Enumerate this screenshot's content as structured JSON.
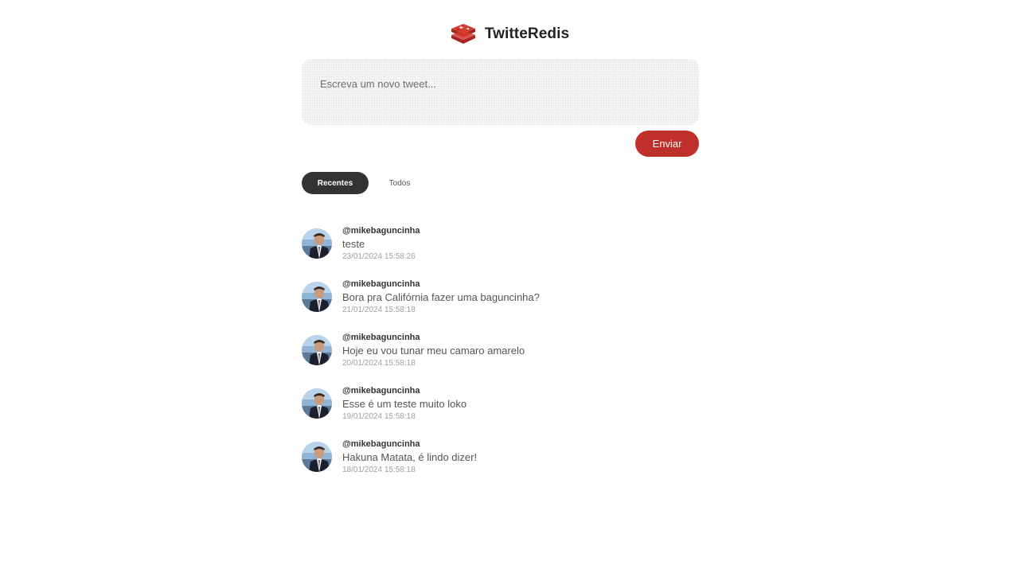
{
  "header": {
    "title": "TwitteRedis",
    "logo_icon": "redis-logo-icon",
    "brand_color": "#c0302b"
  },
  "composer": {
    "placeholder": "Escreva um novo tweet...",
    "value": "",
    "send_label": "Enviar"
  },
  "tabs": [
    {
      "label": "Recentes",
      "active": true
    },
    {
      "label": "Todos",
      "active": false
    }
  ],
  "tweets": [
    {
      "handle": "@mikebaguncinha",
      "text": "teste",
      "time": "23/01/2024 15:58:26"
    },
    {
      "handle": "@mikebaguncinha",
      "text": "Bora pra Califórnia fazer uma baguncinha?",
      "time": "21/01/2024 15:58:18"
    },
    {
      "handle": "@mikebaguncinha",
      "text": "Hoje eu vou tunar meu camaro amarelo",
      "time": "20/01/2024 15:58:18"
    },
    {
      "handle": "@mikebaguncinha",
      "text": "Esse é um teste muito loko",
      "time": "19/01/2024 15:58:18"
    },
    {
      "handle": "@mikebaguncinha",
      "text": "Hakuna Matata, é lindo dizer!",
      "time": "18/01/2024 15:58:18"
    }
  ]
}
